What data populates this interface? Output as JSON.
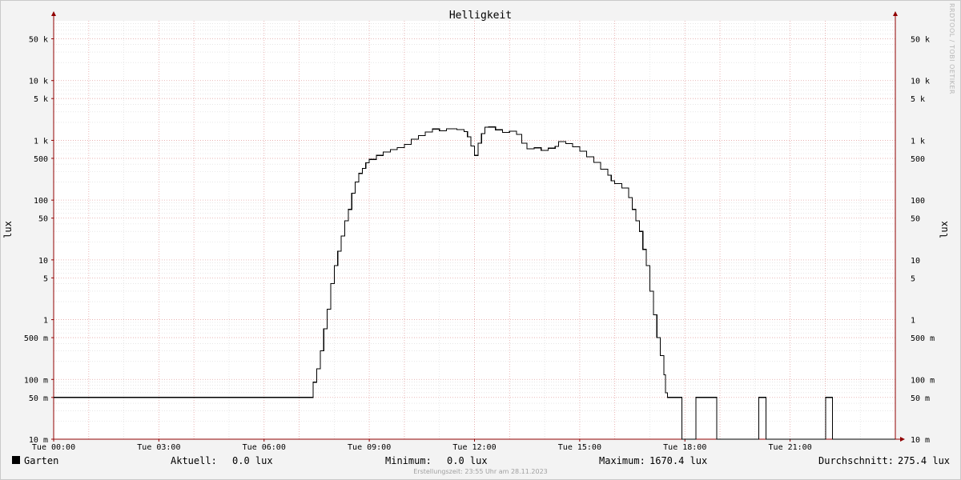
{
  "chart_data": {
    "type": "line",
    "title": "Helligkeit",
    "ylabel": "lux",
    "yscale": "log",
    "ylim": [
      0.01,
      100000
    ],
    "xlim": [
      0,
      24
    ],
    "grid": true,
    "y_ticks": [
      {
        "value": 0.01,
        "label": "10 m"
      },
      {
        "value": 0.05,
        "label": "50 m"
      },
      {
        "value": 0.1,
        "label": "100 m"
      },
      {
        "value": 0.5,
        "label": "500 m"
      },
      {
        "value": 1,
        "label": "1"
      },
      {
        "value": 5,
        "label": "5"
      },
      {
        "value": 10,
        "label": "10"
      },
      {
        "value": 50,
        "label": "50"
      },
      {
        "value": 100,
        "label": "100"
      },
      {
        "value": 500,
        "label": "500"
      },
      {
        "value": 1000,
        "label": "1 k"
      },
      {
        "value": 5000,
        "label": "5 k"
      },
      {
        "value": 10000,
        "label": "10 k"
      },
      {
        "value": 50000,
        "label": "50 k"
      }
    ],
    "x_ticks": [
      {
        "value": 0,
        "label": "Tue 00:00"
      },
      {
        "value": 3,
        "label": "Tue 03:00"
      },
      {
        "value": 6,
        "label": "Tue 06:00"
      },
      {
        "value": 9,
        "label": "Tue 09:00"
      },
      {
        "value": 12,
        "label": "Tue 12:00"
      },
      {
        "value": 15,
        "label": "Tue 15:00"
      },
      {
        "value": 18,
        "label": "Tue 18:00"
      },
      {
        "value": 21,
        "label": "Tue 21:00"
      }
    ],
    "series": [
      {
        "name": "Garten",
        "color": "#000000",
        "points": [
          [
            0,
            0.05
          ],
          [
            7.35,
            0.05
          ],
          [
            7.4,
            0.09
          ],
          [
            7.5,
            0.15
          ],
          [
            7.6,
            0.3
          ],
          [
            7.7,
            0.7
          ],
          [
            7.8,
            1.5
          ],
          [
            7.9,
            4
          ],
          [
            8.0,
            8
          ],
          [
            8.1,
            14
          ],
          [
            8.2,
            25
          ],
          [
            8.3,
            45
          ],
          [
            8.4,
            70
          ],
          [
            8.5,
            130
          ],
          [
            8.6,
            200
          ],
          [
            8.7,
            280
          ],
          [
            8.8,
            340
          ],
          [
            8.9,
            420
          ],
          [
            9.0,
            480
          ],
          [
            9.2,
            560
          ],
          [
            9.4,
            640
          ],
          [
            9.6,
            700
          ],
          [
            9.8,
            760
          ],
          [
            10.0,
            860
          ],
          [
            10.2,
            1050
          ],
          [
            10.4,
            1200
          ],
          [
            10.6,
            1380
          ],
          [
            10.8,
            1550
          ],
          [
            11.0,
            1450
          ],
          [
            11.2,
            1560
          ],
          [
            11.5,
            1520
          ],
          [
            11.7,
            1400
          ],
          [
            11.8,
            1150
          ],
          [
            11.9,
            800
          ],
          [
            12.0,
            560
          ],
          [
            12.1,
            900
          ],
          [
            12.2,
            1300
          ],
          [
            12.3,
            1650
          ],
          [
            12.4,
            1670
          ],
          [
            12.6,
            1500
          ],
          [
            12.8,
            1350
          ],
          [
            13.0,
            1420
          ],
          [
            13.2,
            1250
          ],
          [
            13.35,
            900
          ],
          [
            13.5,
            720
          ],
          [
            13.7,
            750
          ],
          [
            13.9,
            680
          ],
          [
            14.1,
            740
          ],
          [
            14.3,
            790
          ],
          [
            14.4,
            950
          ],
          [
            14.6,
            880
          ],
          [
            14.8,
            780
          ],
          [
            15.0,
            660
          ],
          [
            15.2,
            530
          ],
          [
            15.4,
            430
          ],
          [
            15.6,
            330
          ],
          [
            15.8,
            260
          ],
          [
            15.9,
            210
          ],
          [
            16.0,
            190
          ],
          [
            16.2,
            160
          ],
          [
            16.4,
            110
          ],
          [
            16.5,
            70
          ],
          [
            16.6,
            45
          ],
          [
            16.7,
            30
          ],
          [
            16.8,
            15
          ],
          [
            16.9,
            8
          ],
          [
            17.0,
            3
          ],
          [
            17.1,
            1.2
          ],
          [
            17.2,
            0.5
          ],
          [
            17.3,
            0.25
          ],
          [
            17.4,
            0.12
          ],
          [
            17.45,
            0.06
          ],
          [
            17.5,
            0.05
          ],
          [
            17.9,
            0.05
          ],
          [
            17.91,
            0.01
          ],
          [
            18.3,
            0.01
          ],
          [
            18.31,
            0.05
          ],
          [
            18.9,
            0.05
          ],
          [
            18.91,
            0.01
          ],
          [
            20.1,
            0.01
          ],
          [
            20.11,
            0.05
          ],
          [
            20.3,
            0.05
          ],
          [
            20.31,
            0.01
          ],
          [
            22.0,
            0.01
          ],
          [
            22.01,
            0.05
          ],
          [
            22.2,
            0.05
          ],
          [
            22.21,
            0.01
          ],
          [
            24.0,
            0.01
          ]
        ]
      }
    ]
  },
  "legend": {
    "series_name": "Garten",
    "aktuell_label": "Aktuell:",
    "aktuell_value": "0.0 lux",
    "minimum_label": "Minimum:",
    "minimum_value": "0.0 lux",
    "maximum_label": "Maximum:",
    "maximum_value": "1670.4 lux",
    "durchschnitt_label": "Durchschnitt:",
    "durchschnitt_value": "275.4 lux"
  },
  "footer": "Erstellungszeit: 23:55 Uhr am 28.11.2023",
  "watermark": "RRDTOOL / TOBI OETIKER",
  "colors": {
    "background": "#f3f3f3",
    "plot_background": "#ffffff",
    "major_grid": "#e8a8a8",
    "minor_grid": "#d8d8d8",
    "axis": "#900000",
    "line": "#000000"
  }
}
